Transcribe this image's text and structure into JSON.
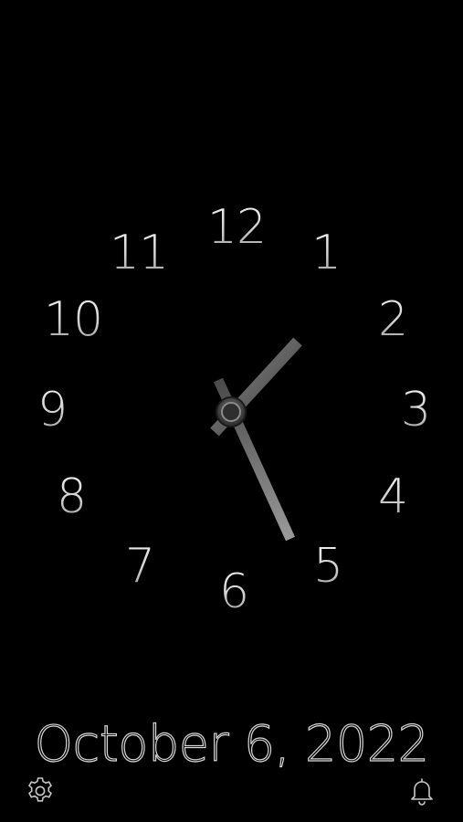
{
  "clock": {
    "numerals": [
      "12",
      "1",
      "2",
      "3",
      "4",
      "5",
      "6",
      "7",
      "8",
      "9",
      "10",
      "11"
    ],
    "time_shown": {
      "hour": 1,
      "minute": 27
    }
  },
  "date": {
    "text": "October 6, 2022"
  },
  "toolbar": {
    "settings_icon": "gear-icon",
    "alarm_icon": "bell-icon"
  },
  "colors": {
    "background": "#000000",
    "foreground": "#d8d8d8"
  }
}
